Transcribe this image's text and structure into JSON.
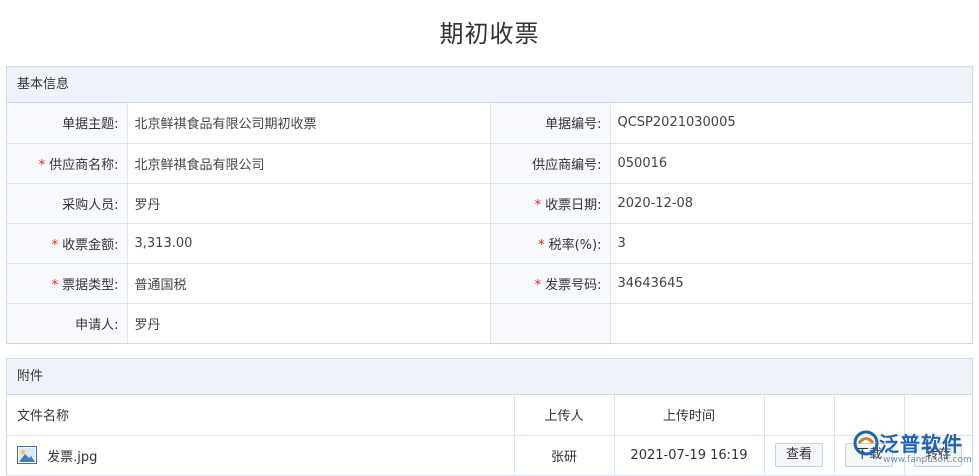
{
  "page": {
    "title": "期初收票"
  },
  "basic_info": {
    "section_title": "基本信息",
    "rows": [
      {
        "left_label": "单据主题:",
        "left_required": false,
        "left_value": "北京鲜祺食品有限公司期初收票",
        "right_label": "单据编号:",
        "right_required": false,
        "right_value": "QCSP2021030005"
      },
      {
        "left_label": "供应商名称:",
        "left_required": true,
        "left_value": "北京鲜祺食品有限公司",
        "right_label": "供应商编号:",
        "right_required": false,
        "right_value": "050016"
      },
      {
        "left_label": "采购人员:",
        "left_required": false,
        "left_value": "罗丹",
        "right_label": "收票日期:",
        "right_required": true,
        "right_value": "2020-12-08"
      },
      {
        "left_label": "收票金额:",
        "left_required": true,
        "left_value": "3,313.00",
        "right_label": "税率(%):",
        "right_required": true,
        "right_value": "3"
      },
      {
        "left_label": "票据类型:",
        "left_required": true,
        "left_value": "普通国税",
        "right_label": "发票号码:",
        "right_required": true,
        "right_value": "34643645"
      },
      {
        "left_label": "申请人:",
        "left_required": false,
        "left_value": "罗丹",
        "right_label": "",
        "right_required": false,
        "right_value": ""
      }
    ]
  },
  "attachments": {
    "section_title": "附件",
    "columns": {
      "file_name": "文件名称",
      "uploader": "上传人",
      "upload_time": "上传时间"
    },
    "files": [
      {
        "name": "发票.jpg",
        "uploader": "张研",
        "time": "2021-07-19 16:19",
        "view_label": "查看",
        "download_label": "下载",
        "transfer_label": "转存"
      }
    ]
  },
  "watermark": {
    "text": "泛普软件",
    "url": "www.fanpusoft.com"
  },
  "colors": {
    "header_bg": "#eef3fa",
    "border": "#cfd9e6",
    "required": "#e02020",
    "brand": "#1f63b4"
  }
}
